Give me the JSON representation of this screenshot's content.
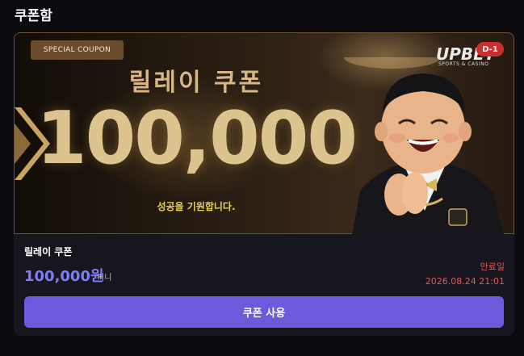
{
  "page": {
    "title": "쿠폰함"
  },
  "coupon": {
    "badge": "SPECIAL COUPON",
    "banner_name": "릴레이 쿠폰",
    "banner_amount": "100,000",
    "banner_message": "성공을 기원합니다.",
    "brand_logo": "UPBET",
    "brand_sub": "SPORTS & CASINO",
    "dday": "D-1",
    "name": "릴레이 쿠폰",
    "amount": "100,000원",
    "unit": "머니",
    "expiry_label": "만료일",
    "expiry_date": "2026.08.24 21:01",
    "use_button": "쿠폰 사용"
  },
  "icons": {
    "chevron": "chevron-right-icon",
    "mascot": "mascot-illustration"
  },
  "colors": {
    "background": "#0d0b0f",
    "card": "#17151d",
    "accent": "#6b5bdc",
    "amount": "#7f7dfa",
    "expiry": "#dd5a5a",
    "gold": "#dcc48f"
  }
}
